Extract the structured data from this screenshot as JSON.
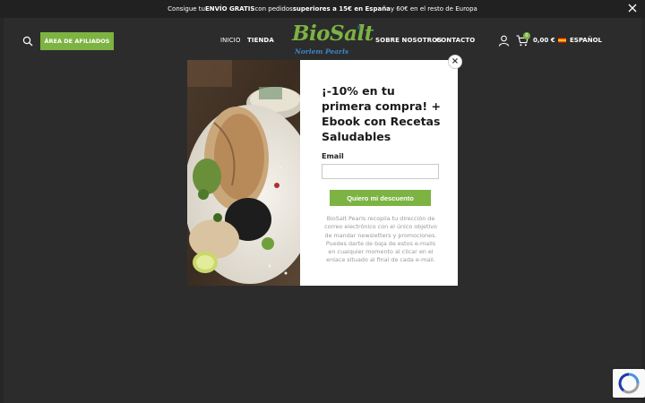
{
  "topbar": {
    "open_glyph": "",
    "pre": "Consigue tu ",
    "free_shipping": "ENVÍO GRATIS",
    "mid": " con pedidos ",
    "threshold": "superiores a 15€ en España",
    "post": " y 60€ en el resto de Europa",
    "close_glyph": ""
  },
  "header": {
    "affiliates_label": "ÁREA DE AFILIADOS",
    "nav_left": [
      "INICIO",
      "TIENDA"
    ],
    "nav_right": [
      "SOBRE NOSOTROS",
      "CONTACTO"
    ],
    "logo": {
      "main": "BioSalt",
      "sub": "Norlem Pearls",
      "registered": "®"
    },
    "cart": {
      "count": "0",
      "total": "0,00 €"
    },
    "language": "ESPAÑOL"
  },
  "popup": {
    "close_glyph": "×",
    "title": "¡-10% en tu primera compra! + Ebook con Recetas Saludables",
    "email_label": "Email",
    "email_value": "",
    "cta_label": "Quiero mi descuento",
    "disclaimer": "BioSalt Pearls recopila tu dirección de correo electrónico con el único objetivo de mandar newsletters y promociones. Puedes darte de baja de estos e-mails en cualquier momento al clicar en el enlace situado al final de cada e-mail."
  },
  "colors": {
    "brand_green": "#7cb342",
    "brand_blue": "#3a86c8",
    "header_bg": "#2c2c2c",
    "topbar_bg": "#212121"
  },
  "icons": [
    "search-icon",
    "user-icon",
    "cart-icon",
    "spain-flag-icon",
    "close-icon",
    "recaptcha-icon"
  ]
}
